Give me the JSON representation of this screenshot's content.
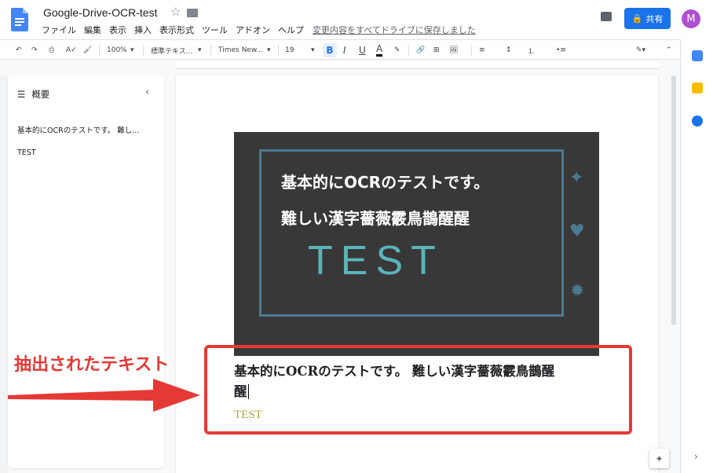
{
  "doc": {
    "title": "Google-Drive-OCR-test",
    "saved_status": "変更内容をすべてドライブに保存しました"
  },
  "menu": [
    "ファイル",
    "編集",
    "表示",
    "挿入",
    "表示形式",
    "ツール",
    "アドオン",
    "ヘルプ"
  ],
  "share": {
    "label": "共有"
  },
  "avatar": {
    "initial": "M",
    "color": "#b04fd0"
  },
  "toolbar": {
    "zoom": "100%",
    "style": "標準テキス...",
    "font": "Times New...",
    "size": "19",
    "bold": "B",
    "italic": "I",
    "underline": "U",
    "text_color": "A"
  },
  "outline": {
    "title": "概要",
    "items": [
      "基本的にOCRのテストです。 難し...",
      "TEST"
    ]
  },
  "image": {
    "line1": "基本的にOCRのテストです。",
    "line2": "難しい漢字薔薇霰鳥鵲醒醒",
    "test": "TEST"
  },
  "ocr": {
    "line1": "基本的にOCRのテストです。 難しい漢字薔薇霰鳥鵲醒",
    "line2": "醒",
    "test": "TEST"
  },
  "annotation": {
    "label": "抽出されたテキスト",
    "color": "#e53935"
  }
}
